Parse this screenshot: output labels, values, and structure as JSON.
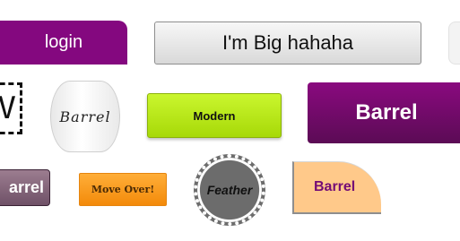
{
  "buttons": {
    "login": "login",
    "big": "I'm Big hahaha",
    "partial_left": "V",
    "barrel_white": "Barrel",
    "modern": "Modern",
    "barrel_purple": "Barrel",
    "barrel_mauve": "arrel",
    "move_over": "Move Over!",
    "feather": "Feather",
    "barrel_peach": "Barrel"
  },
  "colors": {
    "purple": "#84087f",
    "lime": "#b7e716",
    "orange": "#f9a11f",
    "gray_gear": "#6c6c6c",
    "peach": "#ffc98a"
  }
}
